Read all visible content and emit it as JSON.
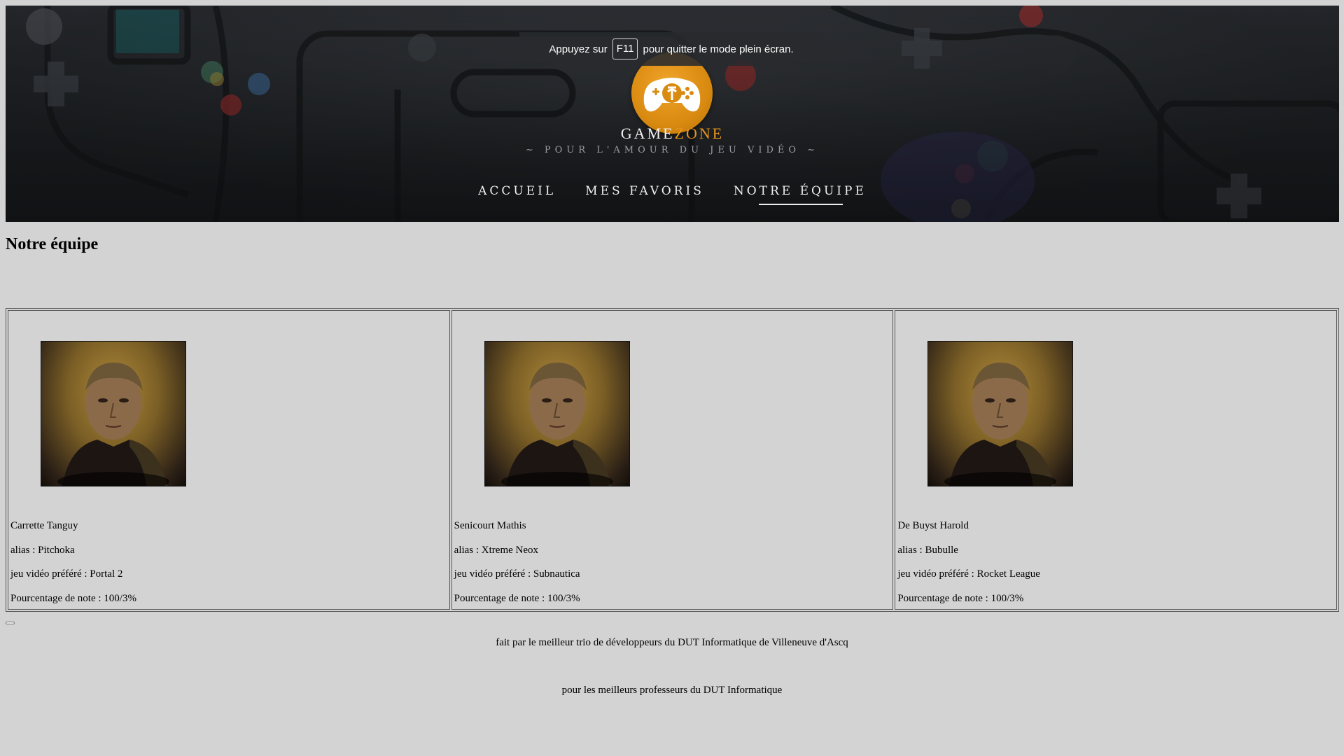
{
  "header": {
    "brand_part1": "GAME",
    "brand_part2": "ZONE",
    "tagline": "~ POUR L'AMOUR DU JEU VIDÉO ~",
    "nav": [
      {
        "label": "ACCUEIL",
        "active": false
      },
      {
        "label": "MES FAVORIS",
        "active": false
      },
      {
        "label": "NOTRE ÉQUIPE",
        "active": true
      }
    ],
    "colors": {
      "accent": "#e8961c",
      "logo": "#e39a1c"
    }
  },
  "fullscreen_notice": {
    "before": "Appuyez sur",
    "key": "F11",
    "after": "pour quitter le mode plein écran."
  },
  "main": {
    "title": "Notre équipe",
    "members": [
      {
        "name": "Carrette Tanguy",
        "alias": "alias : Pitchoka",
        "game": "jeu vidéo préféré : Portal 2",
        "grade": "Pourcentage de note : 100/3%"
      },
      {
        "name": "Senicourt Mathis",
        "alias": "alias : Xtreme Neox",
        "game": "jeu vidéo préféré : Subnautica",
        "grade": "Pourcentage de note : 100/3%"
      },
      {
        "name": "De Buyst Harold",
        "alias": "alias : Bubulle",
        "game": "jeu vidéo préféré : Rocket League",
        "grade": "Pourcentage de note : 100/3%"
      }
    ]
  },
  "footer": {
    "line1": "fait par le meilleur trio de développeurs du DUT Informatique de Villeneuve d'Ascq",
    "line2": "pour les meilleurs professeurs du DUT Informatique"
  },
  "page_background": "#d3d3d3"
}
